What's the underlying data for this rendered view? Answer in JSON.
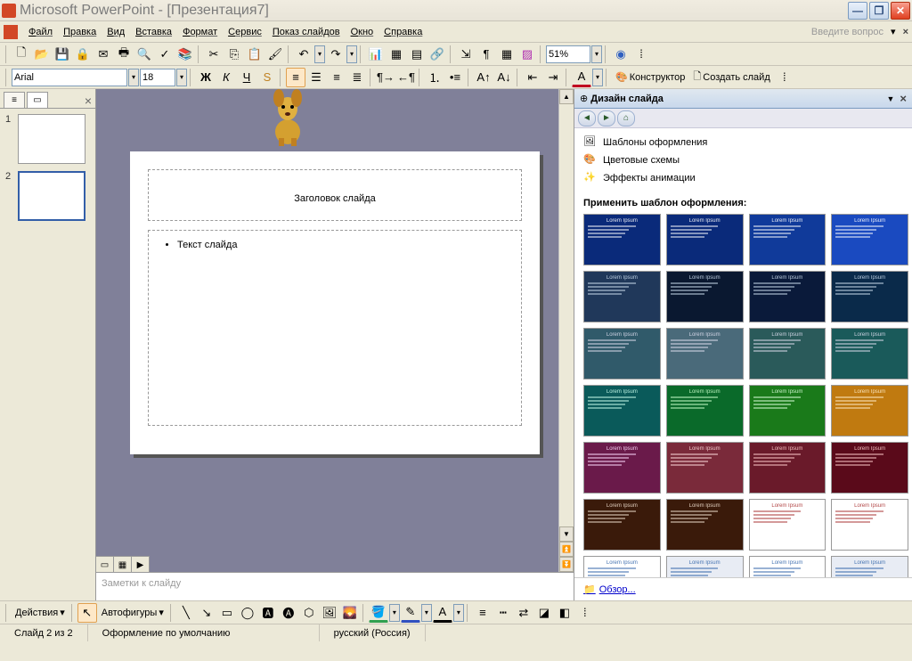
{
  "title": "Microsoft PowerPoint - [Презентация7]",
  "menu": {
    "file": "Файл",
    "edit": "Правка",
    "view": "Вид",
    "insert": "Вставка",
    "format": "Формат",
    "service": "Сервис",
    "slideshow": "Показ слайдов",
    "window": "Окно",
    "help": "Справка",
    "ask": "Введите вопрос"
  },
  "toolbar1": {
    "zoom": "51%"
  },
  "toolbar2": {
    "font": "Arial",
    "size": "18",
    "designer": "Конструктор",
    "new_slide": "Создать слайд"
  },
  "slide_panel": {
    "thumbs": [
      {
        "n": "1",
        "selected": false
      },
      {
        "n": "2",
        "selected": true
      }
    ]
  },
  "slide": {
    "title": "Заголовок слайда",
    "body": "Текст слайда"
  },
  "notes_placeholder": "Заметки к слайду",
  "taskpane": {
    "title": "Дизайн слайда",
    "link_templates": "Шаблоны оформления",
    "link_colors": "Цветовые схемы",
    "link_anim": "Эффекты анимации",
    "apply_label": "Применить шаблон оформления:",
    "browse": "Обзор...",
    "templates": [
      {
        "bg": "#0a2a7a",
        "fg": "#fff"
      },
      {
        "bg": "#0a2a7a",
        "fg": "#fff"
      },
      {
        "bg": "#103a9a",
        "fg": "#fff"
      },
      {
        "bg": "#1a4ac0",
        "fg": "#fff"
      },
      {
        "bg": "#20385a",
        "fg": "#cde"
      },
      {
        "bg": "#0a1830",
        "fg": "#cde"
      },
      {
        "bg": "#0a1a3a",
        "fg": "#cde"
      },
      {
        "bg": "#0a2a4a",
        "fg": "#cde"
      },
      {
        "bg": "#305a6a",
        "fg": "#dde"
      },
      {
        "bg": "#4a6a7a",
        "fg": "#dde"
      },
      {
        "bg": "#2a5a5a",
        "fg": "#dde"
      },
      {
        "bg": "#1a5a5a",
        "fg": "#dde"
      },
      {
        "bg": "#0a5a5a",
        "fg": "#cfe"
      },
      {
        "bg": "#0a6a2a",
        "fg": "#cfc"
      },
      {
        "bg": "#1a7a1a",
        "fg": "#dfd"
      },
      {
        "bg": "#c07a10",
        "fg": "#fec"
      },
      {
        "bg": "#6a1a4a",
        "fg": "#fdf"
      },
      {
        "bg": "#7a2a3a",
        "fg": "#fdd"
      },
      {
        "bg": "#6a1a2a",
        "fg": "#fcc"
      },
      {
        "bg": "#5a0a1a",
        "fg": "#fcc"
      },
      {
        "bg": "#3a1a0a",
        "fg": "#edc"
      },
      {
        "bg": "#3a1a0a",
        "fg": "#edc"
      },
      {
        "bg": "#ffffff",
        "fg": "#a33"
      },
      {
        "bg": "#ffffff",
        "fg": "#a33"
      },
      {
        "bg": "#ffffff",
        "fg": "#36a"
      },
      {
        "bg": "#e8ecf4",
        "fg": "#36a"
      },
      {
        "bg": "#ffffff",
        "fg": "#36a"
      },
      {
        "bg": "#e8ecf4",
        "fg": "#36a"
      }
    ]
  },
  "drawbar": {
    "actions": "Действия",
    "autoshapes": "Автофигуры"
  },
  "status": {
    "slide": "Слайд 2 из 2",
    "design": "Оформление по умолчанию",
    "lang": "русский (Россия)"
  }
}
